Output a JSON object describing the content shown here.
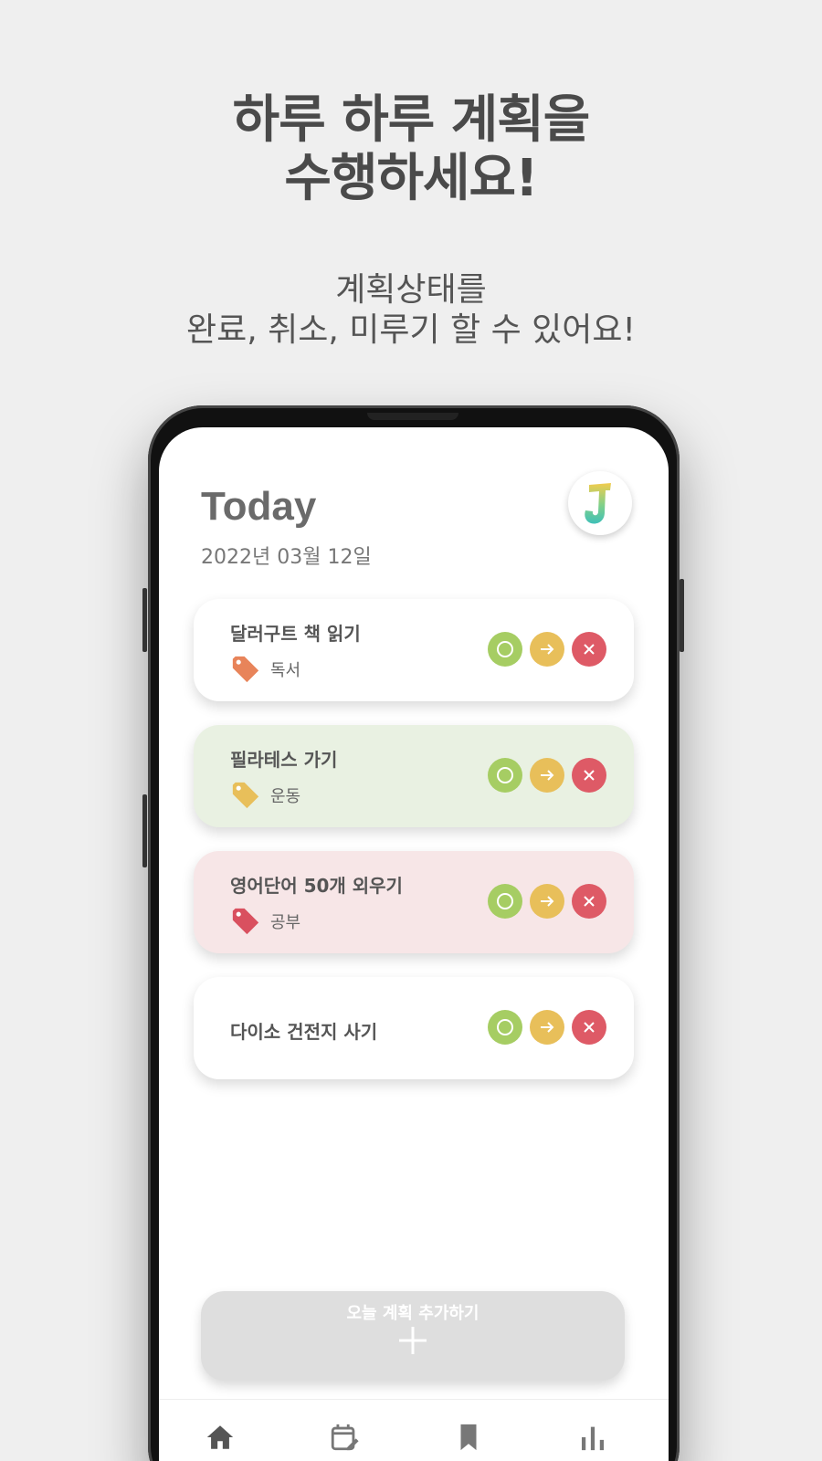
{
  "headline": {
    "line1": "하루 하루 계획을",
    "line2": "수행하세요!"
  },
  "subline": {
    "line1": "계획상태를",
    "line2": "완료, 취소, 미루기 할 수 있어요!"
  },
  "app": {
    "title": "Today",
    "date": "2022년 03월 12일",
    "avatar_letter": "J",
    "plans": [
      {
        "title": "달러구트 책 읽기",
        "tag": "독서",
        "tag_color": "#e8845a",
        "bg": "#ffffff"
      },
      {
        "title": "필라테스 가기",
        "tag": "운동",
        "tag_color": "#e8bf5a",
        "bg": "#e9f1e2"
      },
      {
        "title": "영어단어 50개 외우기",
        "tag": "공부",
        "tag_color": "#d9505f",
        "bg": "#f7e6e7"
      },
      {
        "title": "다이소 건전지 사기",
        "tag": "",
        "tag_color": "",
        "bg": "#ffffff"
      }
    ],
    "actions": {
      "complete_color": "#a6cd63",
      "postpone_color": "#e8bf5a",
      "cancel_color": "#de5a66"
    },
    "add_button_label": "오늘 계획 추가하기",
    "nav": [
      "home-icon",
      "calendar-edit-icon",
      "bookmark-icon",
      "bar-chart-icon"
    ]
  }
}
